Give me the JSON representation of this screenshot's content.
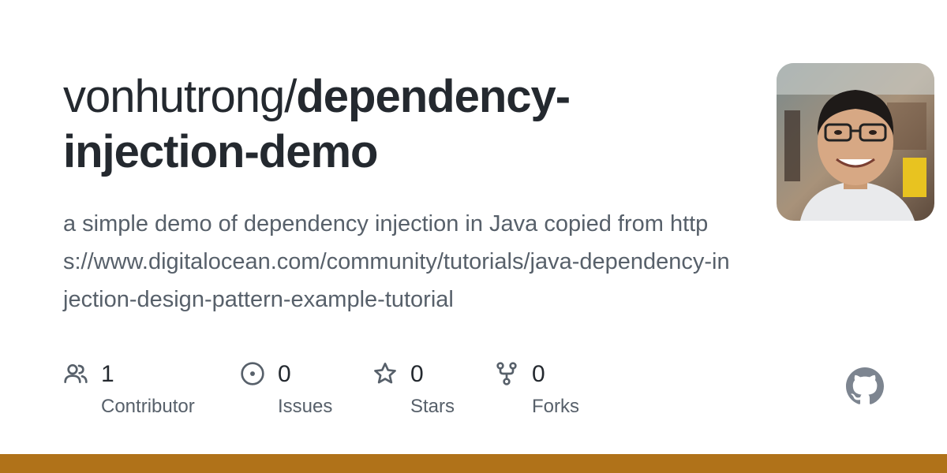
{
  "repo": {
    "owner": "vonhutrong/",
    "name": "dependency-injection-demo",
    "description": "a simple demo of dependency injection in Java copied from https://www.digitalocean.com/community/tutorials/java-dependency-injection-design-pattern-example-tutorial"
  },
  "stats": [
    {
      "icon": "people-icon",
      "value": "1",
      "label": "Contributor"
    },
    {
      "icon": "issue-opened-icon",
      "value": "0",
      "label": "Issues"
    },
    {
      "icon": "star-icon",
      "value": "0",
      "label": "Stars"
    },
    {
      "icon": "repo-forked-icon",
      "value": "0",
      "label": "Forks"
    }
  ],
  "branding": {
    "logo": "github-mark-icon",
    "language_color": "#b07219"
  }
}
